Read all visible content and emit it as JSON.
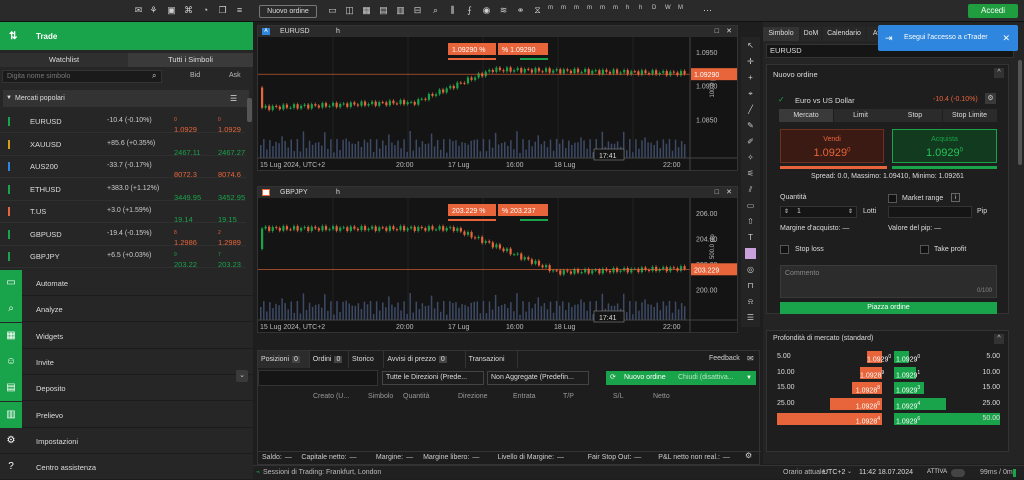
{
  "header": {
    "new_order": "Nuovo ordine",
    "timeframes": [
      "m",
      "m",
      "m",
      "m",
      "m",
      "m",
      "h",
      "h",
      "D",
      "W",
      "M"
    ],
    "timeframe_sub": [
      "1",
      "5",
      "10",
      "15",
      "30",
      "45",
      "1",
      "4",
      "1",
      "1",
      "1"
    ],
    "login": "Accedi"
  },
  "left": {
    "trade": "Trade",
    "tab_watchlist": "Watchlist",
    "tab_all": "Tutti i Simboli",
    "search_placeholder": "Digita nome simbolo",
    "col_bid": "Bid",
    "col_ask": "Ask",
    "popular": "Mercati popolari",
    "rows": [
      {
        "sym": "EURUSD",
        "chg": "-10.4 (-0.10%)",
        "bid": "1.0929",
        "bid_sup": "0",
        "ask": "1.0929",
        "ask_sup": "0",
        "flag": "#19a34a"
      },
      {
        "sym": "XAUUSD",
        "chg": "+85.6 (+0.35%)",
        "bid": "2467.11",
        "bid_sup": "",
        "ask": "2467.27",
        "ask_sup": "",
        "flag": "#d4a017"
      },
      {
        "sym": "AUS200",
        "chg": "-33.7 (-0.17%)",
        "bid": "8072.3",
        "bid_sup": "",
        "ask": "8074.6",
        "ask_sup": "",
        "flag": "#2e86de"
      },
      {
        "sym": "ETHUSD",
        "chg": "+383.0 (+1.12%)",
        "bid": "3449.95",
        "bid_sup": "",
        "ask": "3452.95",
        "ask_sup": "",
        "flag": "#19a34a"
      },
      {
        "sym": "T.US",
        "chg": "+3.0 (+1.59%)",
        "bid": "19.14",
        "bid_sup": "",
        "ask": "19.15",
        "ask_sup": "",
        "flag": "#e8643a"
      },
      {
        "sym": "GBPUSD",
        "chg": "-19.4 (-0.15%)",
        "bid": "1.2986",
        "bid_sup": "8",
        "ask": "1.2989",
        "ask_sup": "2",
        "flag": "#19a34a"
      },
      {
        "sym": "GBPJPY",
        "chg": "+6.5 (+0.03%)",
        "bid": "203.22",
        "bid_sup": "9",
        "ask": "203.23",
        "ask_sup": "7",
        "flag": "#19a34a"
      }
    ],
    "nav": [
      {
        "label": "Automate",
        "icon": "▭"
      },
      {
        "label": "Analyze",
        "icon": "⌕"
      },
      {
        "label": "Widgets",
        "icon": "▦"
      },
      {
        "label": "Invite",
        "icon": "☺"
      },
      {
        "label": "Deposito",
        "icon": "▤"
      },
      {
        "label": "Prelievo",
        "icon": "▥"
      },
      {
        "label": "Impostazioni",
        "icon": "⚙"
      },
      {
        "label": "Centro assistenza",
        "icon": "?"
      }
    ]
  },
  "chart1": {
    "symbol": "EURUSD",
    "sell": "1.0929",
    "sell_sup": "0",
    "buy": "1.0929",
    "buy_sup": "0",
    "price_tag": "1.0929",
    "price_sup": "0",
    "y_ticks": [
      "1.0950",
      "1.0900",
      "1.0850"
    ],
    "scale": "100.0 pip",
    "x_ticks": [
      "15 Lug 2024, UTC+2",
      "20:00",
      "17 Lug",
      "16:00",
      "18 Lug",
      "22:00"
    ],
    "time_label": "17:41"
  },
  "chart2": {
    "symbol": "GBPJPY",
    "sell": "203.22",
    "sell_sup": "9",
    "buy": "203.23",
    "buy_sup": "7",
    "price_tag": "203.22",
    "price_sup": "9",
    "y_ticks": [
      "206.00",
      "204.00",
      "202.00",
      "200.00"
    ],
    "scale": "500.0 pip",
    "x_ticks": [
      "15 Lug 2024, UTC+2",
      "20:00",
      "17 Lug",
      "16:00",
      "18 Lug",
      "22:00"
    ],
    "time_label": "17:41"
  },
  "bottom": {
    "tabs": [
      {
        "label": "Posizioni",
        "count": "0"
      },
      {
        "label": "Ordini",
        "count": "0"
      },
      {
        "label": "Storico",
        "count": ""
      },
      {
        "label": "Avvisi di prezzo",
        "count": "0"
      },
      {
        "label": "Transazioni",
        "count": ""
      }
    ],
    "feedback": "Feedback",
    "filter1": "Tutte le Direzioni (Prede...",
    "filter2": "Non Aggregate (Predefin...",
    "new_order": "Nuovo ordine",
    "close_all": "Chiudi (disattiva...",
    "columns": [
      "Creato (U...",
      "Simbolo",
      "Quantità",
      "Direzione",
      "Entrata",
      "T/P",
      "S/L",
      "Netto"
    ],
    "summary": [
      {
        "label": "Saldo:",
        "value": "—"
      },
      {
        "label": "Capitale netto:",
        "value": "—"
      },
      {
        "label": "Margine:",
        "value": "—"
      },
      {
        "label": "Margine libero:",
        "value": "—"
      },
      {
        "label": "Livello di Margine:",
        "value": "—"
      },
      {
        "label": "Fair Stop Out:",
        "value": "—"
      },
      {
        "label": "P&L netto non real.:",
        "value": "—"
      }
    ]
  },
  "right": {
    "tabs": [
      "Simbolo",
      "DoM",
      "Calendario",
      "Avvisi"
    ],
    "symbol_input": "EURUSD",
    "new_order_title": "Nuovo ordine",
    "instrument": "Euro vs US Dollar",
    "instrument_chg": "-10.4 (-0.10%)",
    "order_types": [
      "Mercato",
      "Limit",
      "Stop",
      "Stop Limite"
    ],
    "sell_label": "Vendi",
    "buy_label": "Acquista",
    "sell_price": "1.0929",
    "sell_sup": "0",
    "buy_price": "1.0929",
    "buy_sup": "0",
    "spread": "Spread: 0.0, Massimo: 1.09410, Minimo: 1.09261",
    "qty_label": "Quantità",
    "qty_value": "1",
    "lots": "Lotti",
    "market_range": "Market range",
    "pip": "Pip",
    "margin_label": "Margine d'acquisto: —",
    "pip_value": "Valore del pip: —",
    "stop_loss": "Stop loss",
    "take_profit": "Take profit",
    "comment_placeholder": "Commento",
    "comment_count": "0/100",
    "place_order": "Piazza ordine",
    "dom_title": "Profondità di mercato (standard)",
    "dom_left": [
      {
        "vol": "5.00",
        "price": "1.0929",
        "sup": "0"
      },
      {
        "vol": "10.00",
        "price": "1.0928",
        "sup": "9"
      },
      {
        "vol": "15.00",
        "price": "1.0928",
        "sup": "8"
      },
      {
        "vol": "25.00",
        "price": "1.0928",
        "sup": "6"
      },
      {
        "vol": "50.00",
        "price": "1.0928",
        "sup": "4"
      }
    ],
    "dom_right": [
      {
        "vol": "5.00",
        "price": "1.0929",
        "sup": "0"
      },
      {
        "vol": "10.00",
        "price": "1.0929",
        "sup": "1"
      },
      {
        "vol": "15.00",
        "price": "1.0929",
        "sup": "3"
      },
      {
        "vol": "25.00",
        "price": "1.0929",
        "sup": "4"
      },
      {
        "vol": "50.00",
        "price": "1.0929",
        "sup": "6"
      }
    ]
  },
  "status": {
    "sessions": "Sessioni di Trading: Frankfurt, London",
    "time_label": "Orario attuale:",
    "tz": "UTC+2",
    "time": "11:42 18.07.2024",
    "active": "ATTIVA",
    "latency": "99ms / 0ms"
  },
  "toast": {
    "text": "Esegui l'accesso a cTrader"
  },
  "colors": {
    "green": "#19a34a",
    "red": "#e8643a",
    "blue": "#2e86de"
  }
}
